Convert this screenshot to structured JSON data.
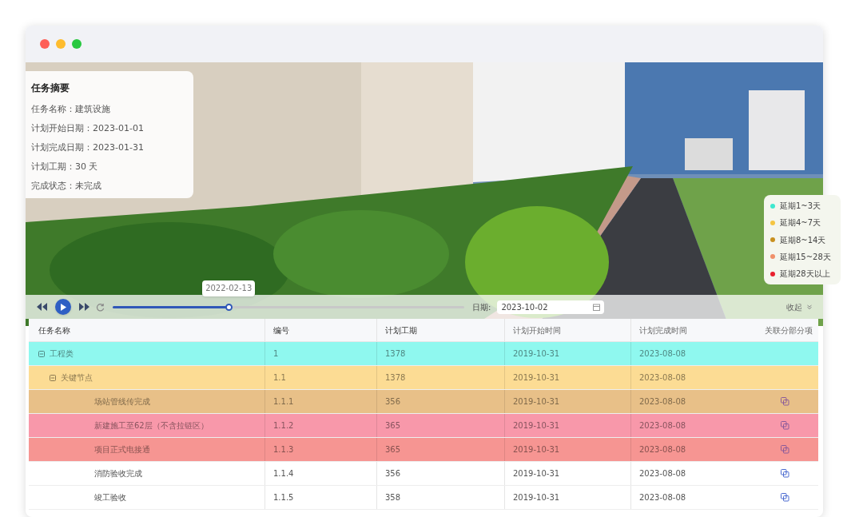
{
  "summary": {
    "title": "任务摘要",
    "lines": [
      "任务名称：建筑设施",
      "计划开始日期：2023-01-01",
      "计划完成日期：2023-01-31",
      "计划工期：30 天",
      "完成状态：未完成"
    ]
  },
  "legend": [
    {
      "label": "延期1~3天",
      "color": "#3ee8cf"
    },
    {
      "label": "延期4~7天",
      "color": "#f5c542"
    },
    {
      "label": "延期8~14天",
      "color": "#c8901e"
    },
    {
      "label": "延期15~28天",
      "color": "#f0906a"
    },
    {
      "label": "延期28天以上",
      "color": "#e8202e"
    }
  ],
  "player": {
    "tooltip": "2022-02-13",
    "level": 0.33,
    "date_label": "日期:",
    "date_value": "2023-10-02",
    "collapse": "收起"
  },
  "table": {
    "columns": [
      "任务名称",
      "编号",
      "计划工期",
      "计划开始时间",
      "计划完成时间",
      "关联分部分项"
    ],
    "rows": [
      {
        "cells": [
          "工程类",
          "1",
          "1378",
          "2019-10-31",
          "2023-08-08"
        ],
        "color": "#8ff8ef",
        "expanded": true,
        "linked": false,
        "children": [
          {
            "cells": [
              "关键节点",
              "1.1",
              "1378",
              "2019-10-31",
              "2023-08-08"
            ],
            "color": "#fcdc94",
            "expanded": true,
            "linked": false,
            "children": [
              {
                "cells": [
                  "场站管线传完成",
                  "1.1.1",
                  "356",
                  "2019-10-31",
                  "2023-08-08"
                ],
                "color": "#e8c088",
                "linked": true
              },
              {
                "cells": [
                  "新建施工至62层（不含拉链区）",
                  "1.1.2",
                  "365",
                  "2019-10-31",
                  "2023-08-08"
                ],
                "color": "#f898aa",
                "linked": true
              },
              {
                "cells": [
                  "项目正式电接通",
                  "1.1.3",
                  "365",
                  "2019-10-31",
                  "2023-08-08"
                ],
                "color": "#f69592",
                "linked": true
              },
              {
                "cells": [
                  "消防验收完成",
                  "1.1.4",
                  "356",
                  "2019-10-31",
                  "2023-08-08"
                ],
                "linked": true
              },
              {
                "cells": [
                  "竣工验收",
                  "1.1.5",
                  "358",
                  "2019-10-31",
                  "2023-08-08"
                ],
                "linked": true
              }
            ]
          }
        ]
      }
    ]
  }
}
